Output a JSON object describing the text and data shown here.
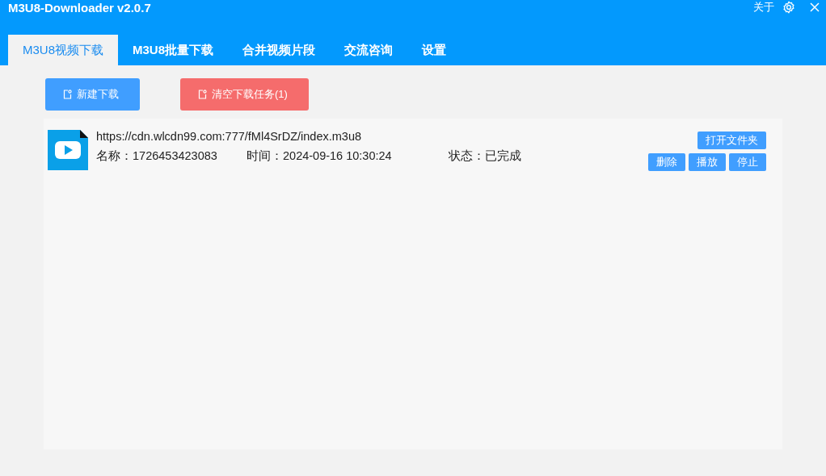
{
  "window": {
    "title": "M3U8-Downloader v2.0.7",
    "about": "关于"
  },
  "tabs": [
    {
      "label": "M3U8视频下载",
      "selected": true
    },
    {
      "label": "M3U8批量下载",
      "selected": false
    },
    {
      "label": "合并视频片段",
      "selected": false
    },
    {
      "label": "交流咨询",
      "selected": false
    },
    {
      "label": "设置",
      "selected": false
    }
  ],
  "toolbar": {
    "buttons": [
      {
        "label": "新建下载",
        "kind": "primary"
      },
      {
        "label": "清空下载任务(1)",
        "kind": "danger"
      }
    ]
  },
  "tasks": [
    {
      "url": "https://cdn.wlcdn99.com:777/fMl4SrDZ/index.m3u8",
      "name": "名称：1726453423083",
      "time": "时间：2024-09-16 10:30:24",
      "status": "状态：已完成",
      "top_actions": [
        "打开文件夹"
      ],
      "actions": [
        "删除",
        "播放",
        "停止"
      ]
    }
  ]
}
